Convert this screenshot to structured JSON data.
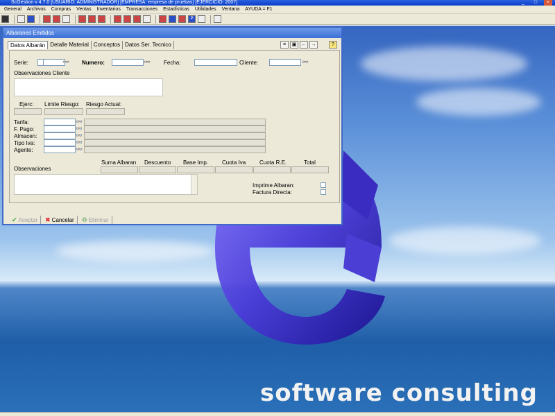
{
  "window": {
    "title": "ScGestion v 4.7.0  [USUARIO: ADMINISTRADOR]  [EMPRESA: empresa de pruebas]  [EJERCICIO: 2007]"
  },
  "menu": [
    "General",
    "Archivos",
    "Compras",
    "Ventas",
    "Inventarios",
    "Transacciones",
    "Estadísticas",
    "Utilidades",
    "Ventana",
    "AYUDA = F1"
  ],
  "dialog": {
    "title": "Albaranes Emitidos",
    "tabs": [
      "Datos Albarán",
      "Detalle Material",
      "Conceptos",
      "Datos Ser. Tecnico"
    ],
    "labels": {
      "serie": "Serie:",
      "numero": "Numero:",
      "fecha": "Fecha:",
      "cliente": "Cliente:",
      "obs_cliente": "Observaciones Cliente",
      "ejerc": "Ejerc:",
      "limite": "Limite Riesgo:",
      "riesgo": "Riesgo Actual:",
      "tarifa": "Tarifa:",
      "fpago": "F. Pago:",
      "almacen": "Almacen:",
      "tipo_iva": "Tipo Iva:",
      "agente": "Agente:",
      "observaciones": "Observaciones",
      "imprime": "Imprime Albaran:",
      "factura": "Factura Directa:"
    },
    "totals_headers": [
      "Suma Albaran",
      "Descuento",
      "Base Imp.",
      "Cuota Iva",
      "Cuota R.E.",
      "Total"
    ],
    "buttons": {
      "aceptar": "Aceptar",
      "cancelar": "Cancelar",
      "eliminar": "Eliminar"
    }
  },
  "brand": "software consulting"
}
